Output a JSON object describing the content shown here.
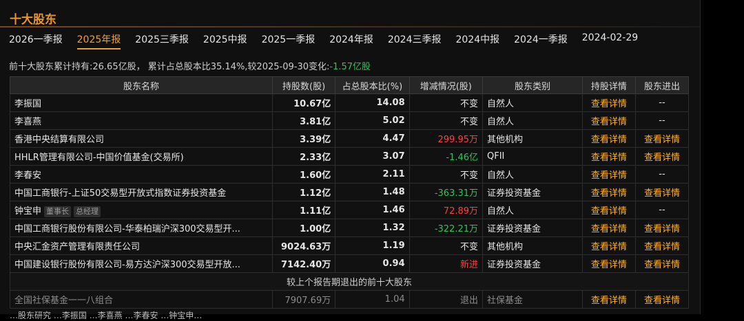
{
  "title": "十大股东",
  "tabs": [
    "2026一季报",
    "2025年报",
    "2025三季报",
    "2025中报",
    "2025一季报",
    "2024年报",
    "2024三季报",
    "2024中报",
    "2024一季报",
    "2024-02-29"
  ],
  "active_tab": 1,
  "summary": {
    "prefix": "前十大股东累计持有:26.65亿股，  累计占总股本比35.14%,较2025-09-30变化:",
    "change": "-1.57亿股"
  },
  "headers": [
    "股东名称",
    "持股数(股)",
    "占总股本比(%)",
    "增减情况(股)",
    "股东类别",
    "持股详情",
    "股东进出"
  ],
  "rows": [
    {
      "name": "李振国",
      "tags": [],
      "shares": "10.67亿",
      "pct": "14.08",
      "change": "不变",
      "change_color": "",
      "category": "自然人",
      "detail": "查看详情",
      "inout": "--"
    },
    {
      "name": "李喜燕",
      "tags": [],
      "shares": "3.81亿",
      "pct": "5.02",
      "change": "不变",
      "change_color": "",
      "category": "自然人",
      "detail": "查看详情",
      "inout": "--"
    },
    {
      "name": "香港中央结算有限公司",
      "tags": [],
      "shares": "3.39亿",
      "pct": "4.47",
      "change": "299.95万",
      "change_color": "red",
      "category": "其他机构",
      "detail": "查看详情",
      "inout": "查看详情"
    },
    {
      "name": "HHLR管理有限公司-中国价值基金(交易所)",
      "tags": [],
      "shares": "2.33亿",
      "pct": "3.07",
      "change": "-1.46亿",
      "change_color": "green",
      "category": "QFII",
      "detail": "查看详情",
      "inout": "查看详情"
    },
    {
      "name": "李春安",
      "tags": [],
      "shares": "1.60亿",
      "pct": "2.11",
      "change": "不变",
      "change_color": "",
      "category": "自然人",
      "detail": "查看详情",
      "inout": "--"
    },
    {
      "name": "中国工商银行-上证50交易型开放式指数证券投资基金",
      "tags": [],
      "shares": "1.12亿",
      "pct": "1.48",
      "change": "-363.31万",
      "change_color": "green",
      "category": "证券投资基金",
      "detail": "查看详情",
      "inout": "查看详情"
    },
    {
      "name": "钟宝申",
      "tags": [
        "董事长",
        "总经理"
      ],
      "shares": "1.11亿",
      "pct": "1.46",
      "change": "72.89万",
      "change_color": "red",
      "category": "自然人",
      "detail": "查看详情",
      "inout": "--"
    },
    {
      "name": "中国工商银行股份有限公司-华泰柏瑞沪深300交易型开...",
      "tags": [],
      "shares": "1.00亿",
      "pct": "1.32",
      "change": "-322.21万",
      "change_color": "green",
      "category": "证券投资基金",
      "detail": "查看详情",
      "inout": "查看详情"
    },
    {
      "name": "中央汇金资产管理有限责任公司",
      "tags": [],
      "shares": "9024.63万",
      "pct": "1.19",
      "change": "不变",
      "change_color": "",
      "category": "其他机构",
      "detail": "查看详情",
      "inout": "查看详情"
    },
    {
      "name": "中国建设银行股份有限公司-易方达沪深300交易型开放...",
      "tags": [],
      "shares": "7142.40万",
      "pct": "0.94",
      "change": "新进",
      "change_color": "red",
      "category": "证券投资基金",
      "detail": "查看详情",
      "inout": "查看详情"
    }
  ],
  "exited_header": "较上个报告期退出的前十大股东",
  "exited_rows": [
    {
      "name": "全国社保基金一一八组合",
      "shares": "7907.69万",
      "pct": "1.04",
      "change": "退出",
      "category": "社保基金",
      "detail": "查看详情",
      "inout": "查看详情"
    }
  ],
  "cut_text": "…股东研究   …李振国   …李喜燕   …李春安   …钟宝申…"
}
